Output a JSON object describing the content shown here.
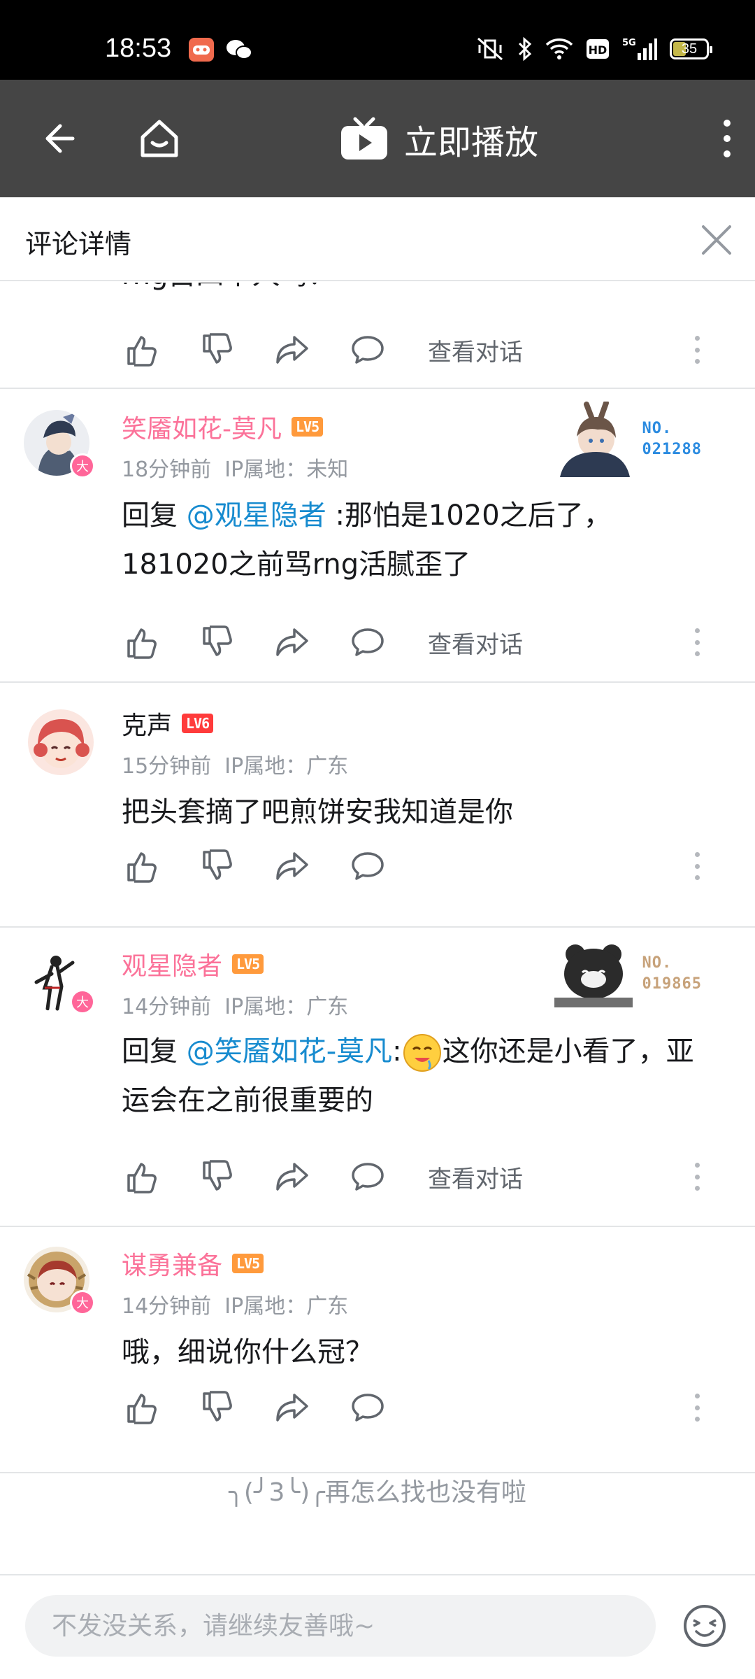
{
  "status_bar": {
    "time": "18:53",
    "battery": "35",
    "icons": [
      "game-center-icon",
      "wechat-icon",
      "mute-vibrate-icon",
      "bluetooth-icon",
      "wifi-icon",
      "hd-icon",
      "5g-signal-icon",
      "battery-icon"
    ]
  },
  "app_bar": {
    "play_now_label": "立即播放",
    "icons": [
      "back-arrow-icon",
      "home-icon",
      "tv-play-icon",
      "more-vertical-icon"
    ]
  },
  "detail": {
    "title": "评论详情"
  },
  "comments": [
    {
      "partial": true,
      "content_tail": "rng占四个人吗？",
      "view_convo": "查看对话"
    },
    {
      "username": "笑靥如花-莫凡",
      "vip": true,
      "level": "LV5",
      "time": "18分钟前",
      "ip": "IP属地：未知",
      "reply_prefix": "回复",
      "mention": "@观星隐者",
      "content": ":那怕是1020之后了，181020之前骂rng活腻歪了",
      "fan_badge": "NO.\n021288",
      "view_convo": "查看对话"
    },
    {
      "username": "克声",
      "vip": false,
      "level": "LV6",
      "time": "15分钟前",
      "ip": "IP属地：广东",
      "content": "把头套摘了吧煎饼安我知道是你"
    },
    {
      "username": "观星隐者",
      "vip": true,
      "level": "LV5",
      "time": "14分钟前",
      "ip": "IP属地：广东",
      "reply_prefix": "回复",
      "mention": "@笑靥如花-莫凡",
      "content_colon": ":",
      "content": "这你还是小看了，亚运会在之前很重要的",
      "fan_badge": "NO.\n019865",
      "view_convo": "查看对话"
    },
    {
      "username": "谋勇兼备",
      "vip": true,
      "level": "LV5",
      "time": "14分钟前",
      "ip": "IP属地：广东",
      "content": "哦，细说你什么冠？"
    }
  ],
  "end_note": "╮(╯3╰)╭再怎么找也没有啦",
  "input": {
    "placeholder": "不发没关系，请继续友善哦~"
  },
  "colors": {
    "vip_name": "#fb7299",
    "mention": "#178bcf",
    "meta": "#9499a0",
    "app_bar": "#454545"
  }
}
